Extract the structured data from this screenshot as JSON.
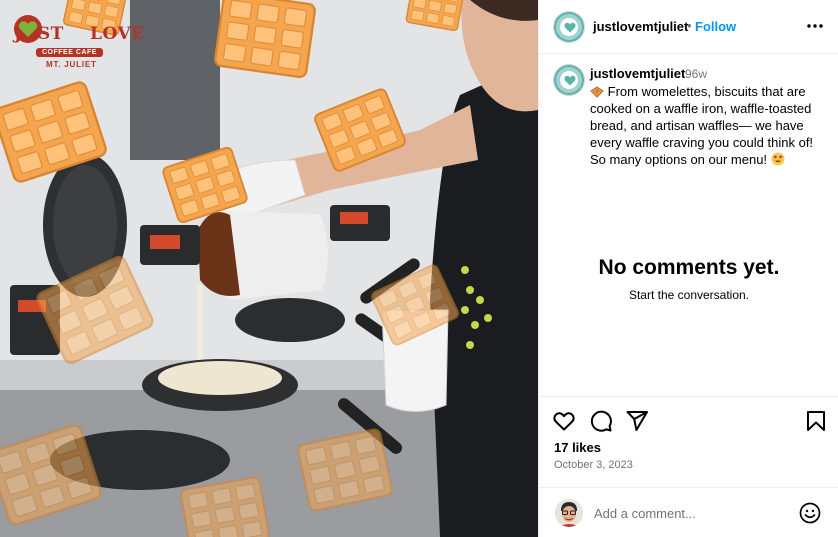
{
  "post": {
    "username": "justlovemtjuliet",
    "follow_label": "Follow",
    "separator": "•",
    "age": "96w",
    "caption_before": "From womelettes, biscuits that are cooked on a waffle iron, waffle-toasted bread, and artisan waffles— we have every waffle craving you could think of! So many options on our menu!",
    "caption_leading_emoji": "waffle-emoji",
    "caption_trailing_emoji": "heart-eyes-emoji",
    "likes": "17 likes",
    "date": "October 3, 2023"
  },
  "comments": {
    "empty_title": "No comments yet.",
    "empty_subtitle": "Start the conversation.",
    "input_placeholder": "Add a comment..."
  },
  "photo_logo": {
    "word1": "JUST",
    "word2": "LOVE",
    "banner": "COFFEE CAFE",
    "location": "MT. JULIET"
  },
  "icons": {
    "like": "heart-icon",
    "comment": "comment-icon",
    "share": "share-icon",
    "save": "bookmark-icon",
    "more": "more-horizontal-icon",
    "emoji": "smile-icon"
  },
  "colors": {
    "accent": "#0095f6",
    "brand_red": "#b53324",
    "waffle": "#f5a54e",
    "secondary_text": "#737373"
  }
}
